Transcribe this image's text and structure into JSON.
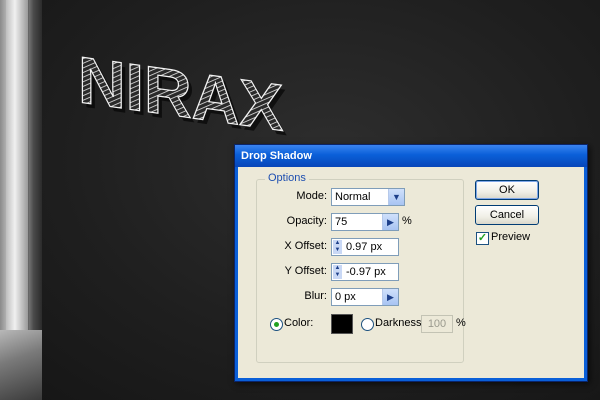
{
  "canvas": {
    "logo_text": "NIRAX"
  },
  "dialog": {
    "title": "Drop Shadow",
    "options_legend": "Options",
    "mode": {
      "label": "Mode:",
      "value": "Normal"
    },
    "opacity": {
      "label": "Opacity:",
      "value": "75",
      "unit": "%"
    },
    "x_offset": {
      "label": "X Offset:",
      "value": "0.97 px"
    },
    "y_offset": {
      "label": "Y Offset:",
      "value": "-0.97 px"
    },
    "blur": {
      "label": "Blur:",
      "value": "0 px"
    },
    "color": {
      "label": "Color:",
      "selected": true,
      "swatch": "#000000"
    },
    "darkness": {
      "label": "Darkness:",
      "value": "100",
      "unit": "%",
      "selected": false
    },
    "ok_label": "OK",
    "cancel_label": "Cancel",
    "preview": {
      "label": "Preview",
      "checked": true
    }
  },
  "colors": {
    "titlebar": "#0a5fd8",
    "dialog_bg": "#ece9d8",
    "canvas_bg": "#222222"
  }
}
